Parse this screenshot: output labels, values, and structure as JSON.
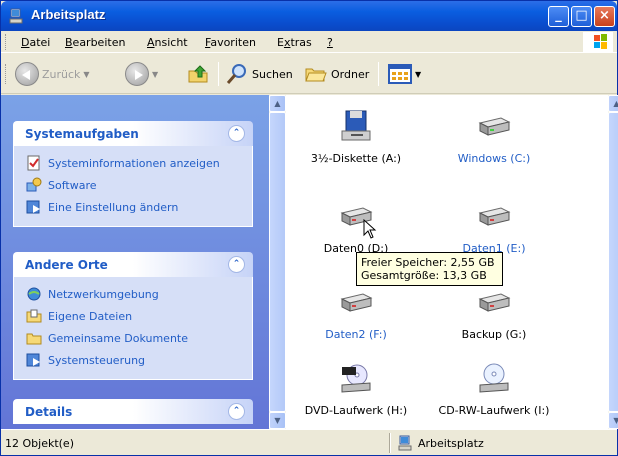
{
  "window": {
    "title": "Arbeitsplatz"
  },
  "menu": [
    {
      "u": "D",
      "rest": "atei"
    },
    {
      "u": "B",
      "rest": "earbeiten"
    },
    {
      "u": "A",
      "rest": "nsicht"
    },
    {
      "u": "F",
      "rest": "avoriten"
    },
    {
      "pre": "E",
      "u": "x",
      "rest": "tras"
    },
    {
      "u": "?",
      "rest": ""
    }
  ],
  "toolbar": {
    "back": "Zurück",
    "search": "Suchen",
    "folders": "Ordner"
  },
  "panels": {
    "system": {
      "title": "Systemaufgaben",
      "items": [
        "Systeminformationen anzeigen",
        "Software",
        "Eine Einstellung ändern"
      ]
    },
    "other": {
      "title": "Andere Orte",
      "items": [
        "Netzwerkumgebung",
        "Eigene Dateien",
        "Gemeinsame Dokumente",
        "Systemsteuerung"
      ]
    },
    "details": {
      "title": "Details"
    }
  },
  "drives": [
    {
      "name": "3½-Diskette (A:)",
      "icon": "floppy-drive-icon"
    },
    {
      "name": "Windows (C:)",
      "icon": "hard-drive-icon"
    },
    {
      "name": "Daten0 (D:)",
      "icon": "hard-drive-icon"
    },
    {
      "name": "Daten1 (E:)",
      "icon": "hard-drive-icon"
    },
    {
      "name": "Daten2 (F:)",
      "icon": "hard-drive-icon"
    },
    {
      "name": "Backup (G:)",
      "icon": "hard-drive-icon"
    },
    {
      "name": "DVD-Laufwerk (H:)",
      "icon": "dvd-drive-icon"
    },
    {
      "name": "CD-RW-Laufwerk (I:)",
      "icon": "cd-drive-icon"
    }
  ],
  "tooltip": {
    "line1": "Freier Speicher: 2,55 GB",
    "line2": "Gesamtgröße: 13,3 GB"
  },
  "status": {
    "count": "12 Objekt(e)",
    "location": "Arbeitsplatz"
  }
}
